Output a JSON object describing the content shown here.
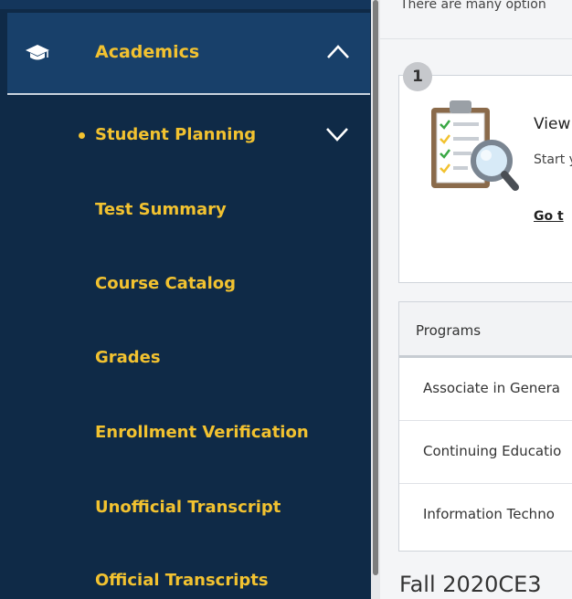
{
  "sidebar": {
    "section": {
      "label": "Academics",
      "icon": "graduation-cap-icon",
      "expanded": true
    },
    "items": [
      {
        "label": "Student Planning",
        "active": true,
        "expandable": true
      },
      {
        "label": "Test Summary"
      },
      {
        "label": "Course Catalog"
      },
      {
        "label": "Grades"
      },
      {
        "label": "Enrollment Verification"
      },
      {
        "label": "Unofficial Transcript"
      },
      {
        "label": "Official Transcripts"
      }
    ]
  },
  "main": {
    "intro_text": "There are many option",
    "step_card": {
      "number": "1",
      "title": "View",
      "description": "Start your",
      "link": "Go t",
      "icon": "clipboard-magnifier-icon"
    },
    "programs_table": {
      "header": "Programs",
      "rows": [
        "Associate in Genera",
        "Continuing Educatio",
        "Information Techno"
      ]
    },
    "term_heading": "Fall 2020CE3"
  },
  "colors": {
    "sidebar_bg": "#0f2a47",
    "active_section_bg": "#18406a",
    "accent_yellow": "#f2c230"
  }
}
